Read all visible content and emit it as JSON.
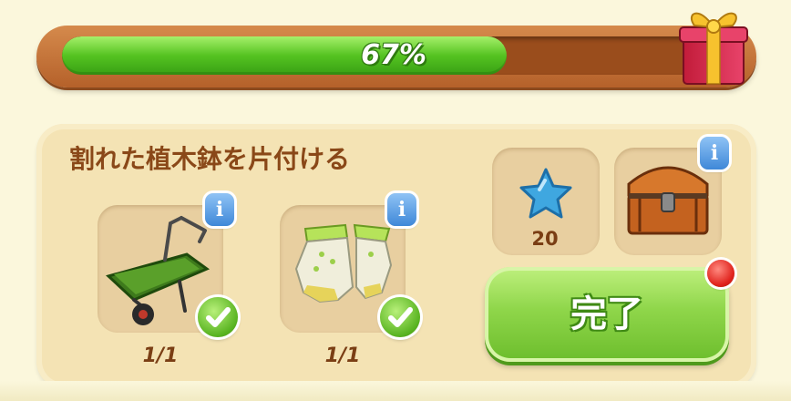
{
  "progress": {
    "label": "67%",
    "value": 0.67,
    "bar_color": "#55c321",
    "frame_color": "#c46f35"
  },
  "gift_icon": "gift-box-icon",
  "task": {
    "title": "割れた植木鉢を片付ける",
    "requirements": [
      {
        "item_icon": "wheelbarrow-icon",
        "count": "1/1",
        "done": true
      },
      {
        "item_icon": "gardening-gloves-icon",
        "count": "1/1",
        "done": true
      }
    ]
  },
  "rewards": [
    {
      "icon": "blue-star-icon",
      "value": "20"
    },
    {
      "icon": "treasure-chest-icon"
    }
  ],
  "info_label": "i",
  "complete_button": {
    "label": "完了",
    "color": "#8fd64a"
  },
  "notification_dot_color": "#e0221c"
}
